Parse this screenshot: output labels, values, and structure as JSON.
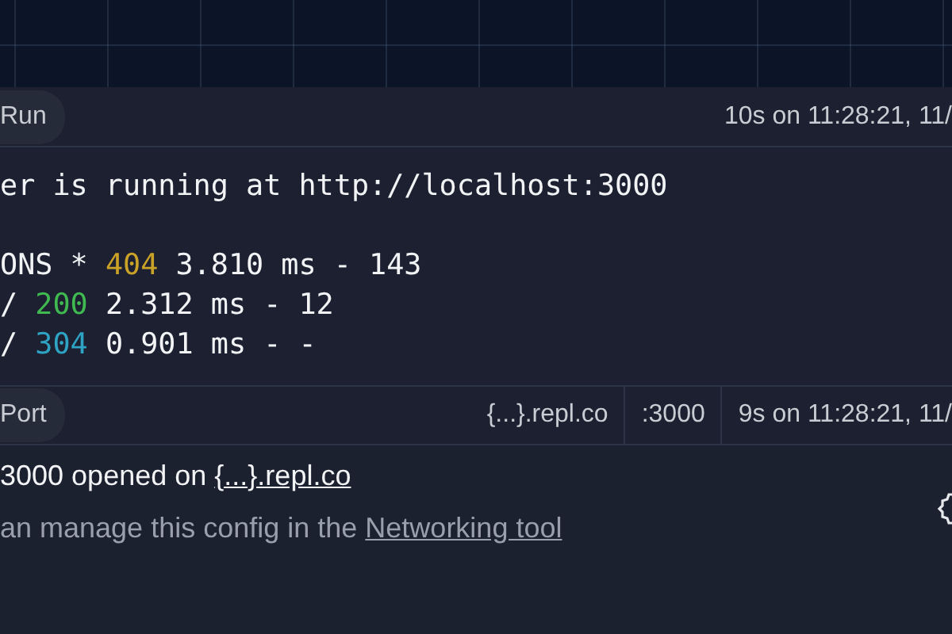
{
  "run_panel": {
    "label": "Run",
    "timestamp": "10s on 11:28:21, 11/",
    "lines": [
      {
        "parts": [
          {
            "text": "er is running at http://localhost:3000"
          }
        ]
      },
      {
        "parts": [
          {
            "text": "ONS * "
          },
          {
            "text": "404",
            "color": "#c9a227"
          },
          {
            "text": " 3.810 ms - 143"
          }
        ]
      },
      {
        "parts": [
          {
            "text": "/ "
          },
          {
            "text": "200",
            "color": "#3fb950"
          },
          {
            "text": " 2.312 ms - 12"
          }
        ]
      },
      {
        "parts": [
          {
            "text": "/ "
          },
          {
            "text": "304",
            "color": "#2ea3c4"
          },
          {
            "text": " 0.901 ms - -"
          }
        ]
      }
    ]
  },
  "port_panel": {
    "label": "Port",
    "host": "{...}.repl.co",
    "port": ":3000",
    "timestamp": "9s on 11:28:21, 11/",
    "message": "3000 opened on",
    "message_link": "{...}.repl.co",
    "hint": "an manage this config in the",
    "hint_link": "Networking tool"
  }
}
